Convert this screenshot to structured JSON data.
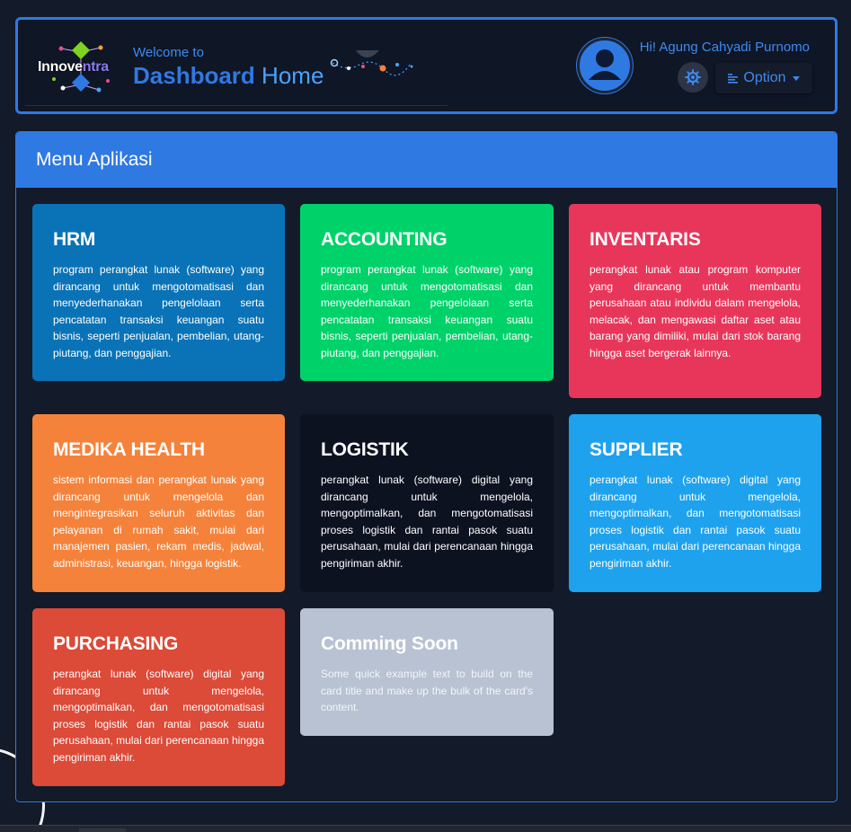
{
  "header": {
    "logo_text_a": "Innove",
    "logo_text_b": "ntra",
    "welcome": "Welcome to",
    "title_bold": "Dashboard",
    "title_light": "Home",
    "greeting": "Hi! Agung Cahyadi Purnomo",
    "option_label": "Option"
  },
  "panel": {
    "title": "Menu Aplikasi"
  },
  "cards": [
    {
      "title": "HRM",
      "text": "program perangkat lunak (software) yang dirancang untuk mengotomatisasi dan menyederhanakan pengelolaan serta pencatatan transaksi keuangan suatu bisnis, seperti penjualan, pembelian, utang-piutang, dan penggajian.",
      "color": "#0a73b7"
    },
    {
      "title": "ACCOUNTING",
      "text": "program perangkat lunak (software) yang dirancang untuk mengotomatisasi dan menyederhanakan pengelolaan serta pencatatan transaksi keuangan suatu bisnis, seperti penjualan, pembelian, utang-piutang, dan penggajian.",
      "color": "#00d26a"
    },
    {
      "title": "INVENTARIS",
      "text": "perangkat lunak atau program komputer yang dirancang untuk membantu perusahaan atau individu dalam mengelola, melacak, dan mengawasi daftar aset atau barang yang dimiliki, mulai dari stok barang hingga aset bergerak lainnya.",
      "color": "#e8365a"
    },
    {
      "title": "MEDIKA HEALTH",
      "text": "sistem informasi dan perangkat lunak yang dirancang untuk mengelola dan mengintegrasikan seluruh aktivitas dan pelayanan di rumah sakit, mulai dari manajemen pasien, rekam medis, jadwal, administrasi, keuangan, hingga logistik.",
      "color": "#f5823a"
    },
    {
      "title": "LOGISTIK",
      "text": "perangkat lunak (software) digital yang dirancang untuk mengelola, mengoptimalkan, dan mengotomatisasi proses logistik dan rantai pasok suatu perusahaan, mulai dari perencanaan hingga pengiriman akhir.",
      "color": "#0d1220"
    },
    {
      "title": "SUPPLIER",
      "text": "perangkat lunak (software) digital yang dirancang untuk mengelola, mengoptimalkan, dan mengotomatisasi proses logistik dan rantai pasok suatu perusahaan, mulai dari perencanaan hingga pengiriman akhir.",
      "color": "#1ea2ee"
    },
    {
      "title": "PURCHASING",
      "text": "perangkat lunak (software) digital yang dirancang untuk mengelola, mengoptimalkan, dan mengotomatisasi proses logistik dan rantai pasok suatu perusahaan, mulai dari perencanaan hingga pengiriman akhir.",
      "color": "#dc4a38"
    },
    {
      "title": "Comming Soon",
      "text": "Some quick example text to build on the card title and make up the bulk of the card's content.",
      "color": "#b8c2d2"
    }
  ],
  "icons": {
    "avatar": "user-icon",
    "theme": "gear-icon",
    "option": "menu-lines-icon"
  }
}
